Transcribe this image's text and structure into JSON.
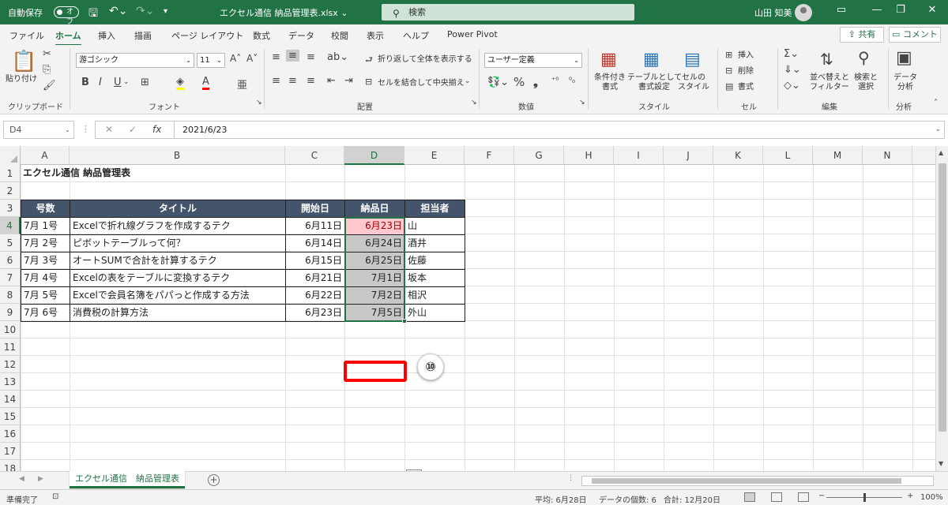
{
  "titlebar": {
    "autosave": "自動保存",
    "autosave_state": "オフ",
    "doc_title": "エクセル通信 納品管理表.xlsx ⌄",
    "search_placeholder": "検索",
    "user": "山田 知美"
  },
  "tabs": [
    "ファイル",
    "ホーム",
    "挿入",
    "描画",
    "ページ レイアウト",
    "数式",
    "データ",
    "校閲",
    "表示",
    "ヘルプ",
    "Power Pivot"
  ],
  "share_label": "共有",
  "comment_label": "コメント",
  "ribbon": {
    "clipboard": {
      "paste": "貼り付け",
      "label": "クリップボード"
    },
    "font": {
      "font_name": "游ゴシック",
      "font_size": "11",
      "label": "フォント"
    },
    "alignment": {
      "wrap": "折り返して全体を表示する",
      "merge": "セルを結合して中央揃え",
      "label": "配置"
    },
    "number": {
      "format": "ユーザー定義",
      "label": "数値"
    },
    "styles": {
      "cond": "条件付き\n書式",
      "table": "テーブルとして\n書式設定",
      "cell": "セルの\nスタイル",
      "label": "スタイル"
    },
    "cells": {
      "insert": "挿入",
      "delete": "削除",
      "format": "書式",
      "label": "セル"
    },
    "editing": {
      "sort": "並べ替えと\nフィルター",
      "find": "検索と\n選択",
      "label": "編集"
    },
    "analysis": {
      "analyze": "データ\n分析",
      "label": "分析"
    }
  },
  "formula_bar": {
    "name_box": "D4",
    "content": "2021/6/23"
  },
  "columns": [
    "A",
    "B",
    "C",
    "D",
    "E",
    "F",
    "G",
    "H",
    "I",
    "J",
    "K",
    "L",
    "M",
    "N"
  ],
  "rows": [
    "1",
    "2",
    "3",
    "4",
    "5",
    "6",
    "7",
    "8",
    "9",
    "10",
    "11",
    "12",
    "13",
    "14",
    "15",
    "16",
    "17",
    "18"
  ],
  "sheet": {
    "title": "エクセル通信 納品管理表",
    "headers": [
      "号数",
      "タイトル",
      "開始日",
      "納品日",
      "担当者"
    ],
    "data": [
      [
        "7月 1号",
        "Excelで折れ線グラフを作成するテク",
        "6月11日",
        "6月23日",
        "山"
      ],
      [
        "7月 2号",
        "ピボットテーブルって何？",
        "6月14日",
        "6月24日",
        "酒井"
      ],
      [
        "7月 3号",
        "オートSUMで合計を計算するテク",
        "6月15日",
        "6月25日",
        "佐藤"
      ],
      [
        "7月 4号",
        "Excelの表をテーブルに変換するテク",
        "6月21日",
        "7月1日",
        "坂本"
      ],
      [
        "7月 5号",
        "Excelで会員名簿をパパっと作成する方法",
        "6月22日",
        "7月2日",
        "相沢"
      ],
      [
        "7月 6号",
        "消費税の計算方法",
        "6月23日",
        "7月5日",
        "外山"
      ]
    ]
  },
  "callout_number": "⑩",
  "sheet_tab": "エクセル通信　納品管理表",
  "status": {
    "ready": "準備完了",
    "average": "平均: 6月28日",
    "count": "データの個数: 6",
    "sum": "合計: 12月20日",
    "zoom": "100%"
  },
  "colors": {
    "accent": "#217346",
    "header_fill": "#44546a",
    "highlight": "#ffc7ce",
    "highlight_text": "#9c0006",
    "callout_border": "#ff0000"
  }
}
